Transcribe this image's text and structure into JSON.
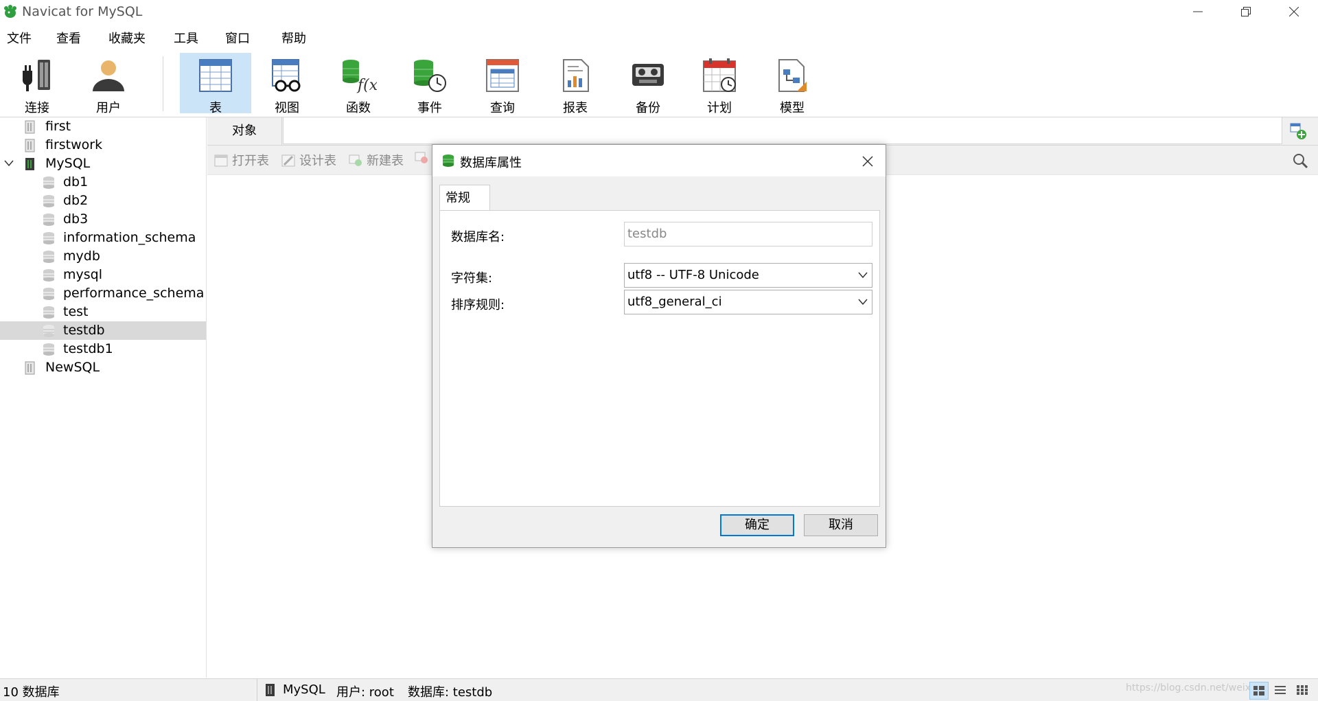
{
  "window": {
    "title": "Navicat for MySQL"
  },
  "menu": [
    "文件",
    "查看",
    "收藏夹",
    "工具",
    "窗口",
    "帮助"
  ],
  "toolbar": [
    "连接",
    "用户",
    "表",
    "视图",
    "函数",
    "事件",
    "查询",
    "报表",
    "备份",
    "计划",
    "模型"
  ],
  "toolbar_active": "表",
  "tree": {
    "items": [
      {
        "label": "first",
        "level": 0,
        "type": "connection"
      },
      {
        "label": "firstwork",
        "level": 0,
        "type": "connection"
      },
      {
        "label": "MySQL",
        "level": 0,
        "type": "connection-open",
        "expanded": true
      },
      {
        "label": "db1",
        "level": 1,
        "type": "database"
      },
      {
        "label": "db2",
        "level": 1,
        "type": "database"
      },
      {
        "label": "db3",
        "level": 1,
        "type": "database"
      },
      {
        "label": "information_schema",
        "level": 1,
        "type": "database"
      },
      {
        "label": "mydb",
        "level": 1,
        "type": "database"
      },
      {
        "label": "mysql",
        "level": 1,
        "type": "database"
      },
      {
        "label": "performance_schema",
        "level": 1,
        "type": "database"
      },
      {
        "label": "test",
        "level": 1,
        "type": "database"
      },
      {
        "label": "testdb",
        "level": 1,
        "type": "database",
        "selected": true
      },
      {
        "label": "testdb1",
        "level": 1,
        "type": "database"
      },
      {
        "label": "NewSQL",
        "level": 0,
        "type": "connection"
      }
    ]
  },
  "objects": {
    "tab": "对象",
    "actions": [
      "打开表",
      "设计表",
      "新建表"
    ]
  },
  "dialog": {
    "title": "数据库属性",
    "tab": "常规",
    "db_name_label": "数据库名:",
    "db_name_value": "testdb",
    "charset_label": "字符集:",
    "charset_value": "utf8 -- UTF-8 Unicode",
    "collation_label": "排序规则:",
    "collation_value": "utf8_general_ci",
    "ok": "确定",
    "cancel": "取消"
  },
  "status": {
    "count": "10 数据库",
    "connection": "MySQL",
    "user": "用户: root",
    "database": "数据库: testdb",
    "watermark": "https://blog.csdn.net/weix..."
  },
  "colors": {
    "accent": "#0078d7",
    "active_tool": "#cce4f7",
    "db_green": "#3aa53a"
  }
}
